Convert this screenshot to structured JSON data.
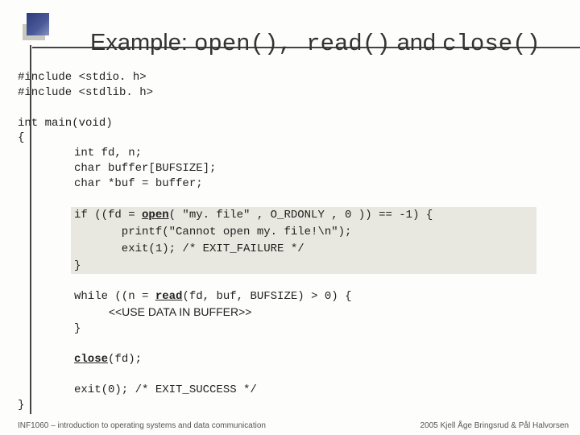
{
  "title": {
    "pre": "Example:",
    "c1": "open()",
    "c2": ", ",
    "c3": "read()",
    "c4": " and ",
    "c5": "close()"
  },
  "code": {
    "inc1": "#include <stdio. h>",
    "inc2": "#include <stdlib. h>",
    "main": "int main(void)",
    "ob": "{",
    "d1": "int fd, n;",
    "d2": "char buffer[BUFSIZE];",
    "d3": "char *buf = buffer;",
    "if1a": "if ((fd = ",
    "if1b": "open",
    "if1c": "( \"my. file\" , O_RDONLY , 0 )) == -1) {",
    "if2": "       printf(\"Cannot open my. file!\\n\");",
    "if3": "       exit(1); /* EXIT_FAILURE */",
    "if4": "}",
    "w1a": "while ((n = ",
    "w1b": "read",
    "w1c": "(fd, buf, BUFSIZE) > 0) {",
    "w2": "<<USE DATA IN BUFFER>>",
    "w3": "}",
    "cl1": "close",
    "cl2": "(fd);",
    "ex": "exit(0); /* EXIT_SUCCESS */",
    "cb": "}"
  },
  "footer": {
    "left": "INF1060 – introduction to operating systems and data communication",
    "right": "2005  Kjell Åge Bringsrud & Pål Halvorsen"
  }
}
